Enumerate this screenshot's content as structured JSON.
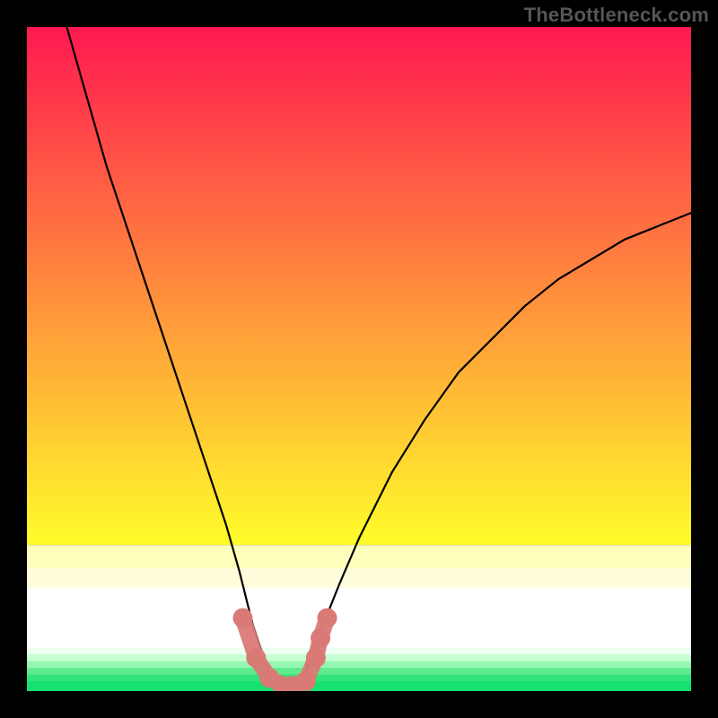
{
  "watermark": "TheBottleneck.com",
  "chart_data": {
    "type": "line",
    "title": "",
    "xlabel": "",
    "ylabel": "",
    "xlim": [
      0,
      100
    ],
    "ylim": [
      0,
      100
    ],
    "series": [
      {
        "name": "curve",
        "style": "black-line",
        "x": [
          6,
          8,
          10,
          12,
          14,
          16,
          18,
          20,
          22,
          24,
          26,
          28,
          30,
          32,
          33,
          34,
          35,
          36,
          37,
          38,
          39,
          40,
          41,
          42,
          43,
          45,
          47,
          50,
          55,
          60,
          65,
          70,
          75,
          80,
          85,
          90,
          95,
          100
        ],
        "y": [
          100,
          93,
          86,
          79,
          73,
          67,
          61,
          55,
          49,
          43,
          37,
          31,
          25,
          18,
          14,
          10,
          7,
          4,
          2,
          1,
          0.5,
          0.5,
          1,
          3,
          6,
          11,
          16,
          23,
          33,
          41,
          48,
          53,
          58,
          62,
          65,
          68,
          70,
          72
        ]
      },
      {
        "name": "dots",
        "style": "salmon-dots",
        "x": [
          32.5,
          34.5,
          36.5,
          38.5,
          40.0,
          42.0,
          43.5,
          44.2,
          45.2
        ],
        "y": [
          11,
          5,
          2,
          0.8,
          0.8,
          1.5,
          5,
          8,
          11
        ]
      }
    ],
    "background_bands": [
      {
        "from": 0.0,
        "to": 0.78,
        "type": "gradient",
        "top": "#ff1850",
        "bottom": "#fffd2a"
      },
      {
        "from": 0.78,
        "to": 0.815,
        "color": "#ffffbd"
      },
      {
        "from": 0.815,
        "to": 0.845,
        "color": "#fffddc"
      },
      {
        "from": 0.845,
        "to": 0.935,
        "color": "#ffffff"
      },
      {
        "from": 0.935,
        "to": 0.945,
        "color": "#ecfff0"
      },
      {
        "from": 0.945,
        "to": 0.955,
        "color": "#c6ffd2"
      },
      {
        "from": 0.955,
        "to": 0.965,
        "color": "#96f7b0"
      },
      {
        "from": 0.965,
        "to": 0.975,
        "color": "#61eb8f"
      },
      {
        "from": 0.975,
        "to": 0.985,
        "color": "#30e47a"
      },
      {
        "from": 0.985,
        "to": 1.0,
        "color": "#15e070"
      }
    ]
  }
}
